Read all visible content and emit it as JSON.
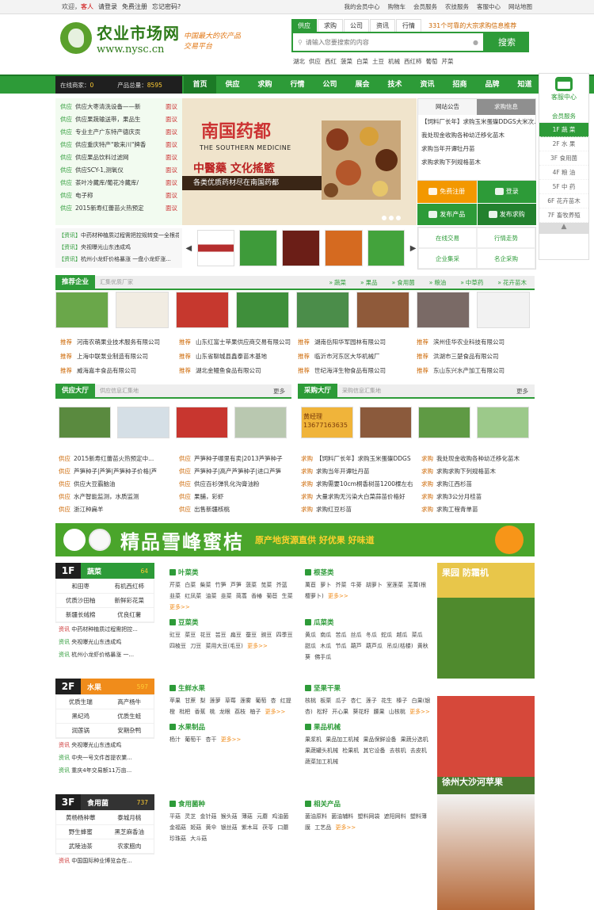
{
  "topbar": {
    "welcome": "欢迎，",
    "guest": "客人",
    "login": "请登录",
    "register": "免费注册",
    "forgot": "忘记密码?",
    "links": [
      "我的会员中心",
      "购物车",
      "会员服务",
      "农技服务",
      "客服中心",
      "网站地图"
    ]
  },
  "logo": {
    "name": "农业市场网",
    "url": "www.nysc.cn",
    "slogan1": "中国最大的农产品",
    "slogan2": "交易平台"
  },
  "search": {
    "tabs": [
      "供应",
      "求购",
      "公司",
      "资讯",
      "行情"
    ],
    "notice": "331个可靠的大宗求购信息推荐",
    "placeholder": "请输入您要搜索的内容",
    "button": "搜索",
    "hot": [
      "湖北",
      "供应",
      "西红",
      "菠菜",
      "白菜",
      "土豆",
      "机械",
      "西红柿",
      "葡萄",
      "芹菜"
    ]
  },
  "nav": {
    "online_label": "在线商家：",
    "online_value": "0",
    "products_label": "产品总量：",
    "products_value": "8595",
    "items": [
      "首页",
      "供应",
      "求购",
      "行情",
      "公司",
      "展会",
      "技术",
      "资讯",
      "招商",
      "品牌",
      "知道"
    ]
  },
  "service": {
    "title": "客服中心",
    "member": "会员服务",
    "floors": [
      "1F 蔬 菜",
      "2F 水 果",
      "3F 食用菌",
      "4F 粮 油",
      "5F 中 药",
      "6F 花卉苗木",
      "7F 畜牧养殖"
    ]
  },
  "supply_list": [
    {
      "tag": "供应",
      "text": "供应大枣清洗设备——新",
      "red": "面议"
    },
    {
      "tag": "供应",
      "text": "供应果蔬输送带，果品生",
      "red": "面议"
    },
    {
      "tag": "供应",
      "text": "专业主产广东特产德庆贡",
      "red": "面议"
    },
    {
      "tag": "供应",
      "text": "供应重庆特产\"歌来川\"牌香",
      "red": "面议"
    },
    {
      "tag": "供应",
      "text": "供应果品饮料过滤网",
      "red": "面议"
    },
    {
      "tag": "供应",
      "text": "供应SCY-1,测氧仪",
      "red": "面议"
    },
    {
      "tag": "供应",
      "text": "茶叶冷藏库/葡花冷藏库/",
      "red": "面议"
    },
    {
      "tag": "供应",
      "text": "电子称",
      "red": "面议"
    },
    {
      "tag": "供应",
      "text": "2015新寿红蕾苗火热预定",
      "red": "面议"
    }
  ],
  "banner": {
    "t1a": "南国",
    "t1b": "药都",
    "t2": "THE SOUTHERN MEDICINE",
    "t3": "中醫藥 文化搖籃",
    "t4": "各类优质药材尽在南国药都"
  },
  "notice": {
    "tabs": [
      "网站公告",
      "求购信息"
    ],
    "items": [
      "【饲料厂长年】求购玉米蛋碟DDGS大米次...",
      "我处现金收购各种幼迁移化苗木",
      "求购当年开谭牡丹苗",
      "求购求购下列规格苗木"
    ]
  },
  "actions": [
    {
      "label": "免费注册",
      "style": "orange"
    },
    {
      "label": "登录",
      "style": "green"
    },
    {
      "label": "发布产品",
      "style": "green"
    },
    {
      "label": "发布求购",
      "style": "dark"
    }
  ],
  "quick": [
    "在线交易",
    "行情走势",
    "企业集采",
    "名企采购"
  ],
  "news3": [
    {
      "tag": "【资讯】",
      "text": "中药材种植质过程需把控规转变一全根花"
    },
    {
      "tag": "【资讯】",
      "text": "央视曝光山东违成鸡"
    },
    {
      "tag": "【资讯】",
      "text": "杭州小龙虾价格暴涨 一盘小龙虾涨..."
    }
  ],
  "enterprise": {
    "title": "推荐企业",
    "sub": "汇集优质厂家",
    "cats": [
      "蔬菜",
      "果品",
      "食用菌",
      "粮油",
      "中草药",
      "花卉苗木"
    ],
    "list": [
      "河南农萌果业技术服务有限公司",
      "山东红富士苹果供应商交易有限公司",
      "湖南岳阳华军园林有限公司",
      "滨州佳华农业科技有限公司",
      "上海中联泵业制造有限公司",
      "山东省聊城县鑫泰苗木基地",
      "临沂市河东区大华机械厂",
      "洪湖市三楚食品有限公司",
      "威海嘉丰食品有限公司",
      "湖北金鳗鱼食品有限公司",
      "世纪海洋生物食品有限公司",
      "东山东兴水产加工有限公司"
    ],
    "prefix": "推荐"
  },
  "supply_hall": {
    "title": "供应大厅",
    "sub": "供应信息汇集地",
    "more": "更多",
    "tag": "供应",
    "items": [
      "2015新寿红蕾苗火热预定中...",
      "芦笋种子哪里有卖|2013芦笋种子",
      "芦笋种子|芦笋|芦笋种子价格|芦",
      "芦笋种子|高产芦笋种子|进口芦笋",
      "供应大豆霸脑油",
      "供应百衫弹乳化沟膏油粉",
      "水产智能监测，水质监测",
      "果脯，彩虾",
      "浙江种扁羊",
      "出售新疆核桃"
    ]
  },
  "purchase_hall": {
    "title": "采购大厅",
    "sub": "采购信息汇集地",
    "more": "更多",
    "tag": "求购",
    "seal_text": "黄经理 13677163635",
    "items": [
      "【饲料厂长年】求购玉米蛋碟DDGS",
      "我处现金收购各种幼迁移化苗木",
      "求购当年开谭牡丹苗",
      "求购求购下列规格苗木",
      "求购需要10cm桐香树苗1200棵左右",
      "求购江西杉苗",
      "大量求购无污染大白菜蒜苗价格好",
      "求购3公分月桂苗",
      "求购红豆杉苗",
      "求购工程青单苗"
    ]
  },
  "ad": {
    "t1": "精品雪峰蜜桔",
    "t2": "原产地货源直供 好优果 好味道"
  },
  "floors": [
    {
      "num": "1F",
      "name": "蔬菜",
      "count": "64",
      "style": "green",
      "grid": [
        "和田枣",
        "有机西红柿",
        "优质沙田柚",
        "新鲜彩花菜",
        "新疆长绒棉",
        "优良红薯"
      ],
      "news": [
        {
          "t": "资讯",
          "c": "r",
          "x": "中药材种植质过程需把控..."
        },
        {
          "t": "资讯",
          "c": "g",
          "x": "央视曝光山东违成鸡"
        },
        {
          "t": "资讯",
          "c": "g",
          "x": "杭州小龙虾价格暴涨 一..."
        }
      ],
      "cats": [
        {
          "h": "叶菜类",
          "p": "芹菜 白菜 柴菜 竹笋 芦笋 菠菜 苋菜 芥蓝 韭菜 红凤菜 油菜 韭菜 茼蒿 香椿 菊苣 生菜",
          "more": "更多>>"
        },
        {
          "h": "根茎类",
          "p": "萬苣 萝卜 芥菜 牛蒡 胡萝卜 室莲菜 芜菁(根樱萝卜)",
          "more": "更多>>"
        },
        {
          "h": "豆菜类",
          "p": "豇豆 菜豆 花豆 芸豆 扁豆 蚕豆 豌豆 四季豆 四棱豆 刀豆 菜用大豆(毛豆)",
          "more": "更多>>"
        },
        {
          "h": "瓜菜类",
          "p": "黄瓜 南瓜 苦瓜 丝瓜 冬瓜 蛇瓜 越瓜 菜瓜 甜瓜 木瓜 节瓜 葫芦 葫芦瓜 吊瓜(栝楼) 黄秋葵 佛手瓜",
          "more": ""
        }
      ],
      "ad_text": "果园 防霜机"
    },
    {
      "num": "2F",
      "name": "水果",
      "count": "597",
      "style": "orange",
      "grid": [
        "优质生瑞",
        "高产杨牛",
        "黑纪鸡",
        "优质生蛙",
        "润莲锅",
        "安期杂鸭"
      ],
      "news": [
        {
          "t": "资讯",
          "c": "r",
          "x": "央视曝光山东违成鸡"
        },
        {
          "t": "资讯",
          "c": "g",
          "x": "中央一号文件首提农業..."
        },
        {
          "t": "资讯",
          "c": "g",
          "x": "重庆4年交易额11万亩..."
        }
      ],
      "cats": [
        {
          "h": "生鲜水果",
          "p": "苹果 甘蔗 梨 莲萝 草莓 莲雾 葡萄 杏 红提 橙 枇杷 香蕉 桃 龙眼 荔枝 柚子",
          "more": "更多>>"
        },
        {
          "h": "坚果干果",
          "p": "核桃 板栗 瓜子 杏仁 莲子 花生 榛子 白果(银杏) 松籽 开心果 葵花籽 腰果 山核桃",
          "more": "更多>>"
        },
        {
          "h": "水果制品",
          "p": "杨汁 葡萄干 杏干",
          "more": "更多>>"
        },
        {
          "h": "果品机械",
          "p": "果浆机 果品加工机械 果品保鲜设备 果蔬分选机 果蔬罐头机械 检果机 其它设备 去核机 去皮机 蔬菜加工机械",
          "more": ""
        }
      ],
      "ad_text": "徐州大沙河苹果"
    },
    {
      "num": "3F",
      "name": "食用菌",
      "count": "737",
      "style": "dark",
      "grid": [
        "黄杨杨种蕈",
        "泰城月桃",
        "野生蜂蜜",
        "黑芝麻香油",
        "武陵油茶",
        "农家腊肉"
      ],
      "news": [
        {
          "t": "资讯",
          "c": "r",
          "x": "中国国际种业博览会在..."
        }
      ],
      "cats": [
        {
          "h": "食用菌种",
          "p": "平菇 灵芝 金针菇 猴头菇 薄菇 元蘑 鸡油菌 金福菇 姬菇 黄伞 银丝菇 紫木耳 茯苓 口蘑 珍珠菇 大斗菇",
          "more": ""
        },
        {
          "h": "相关产品",
          "p": "菌油原料 菌油辅料 塑料网袋 遮阳网料 塑料薄膜 工艺品",
          "more": "更多>>"
        }
      ],
      "ad_text": ""
    }
  ]
}
